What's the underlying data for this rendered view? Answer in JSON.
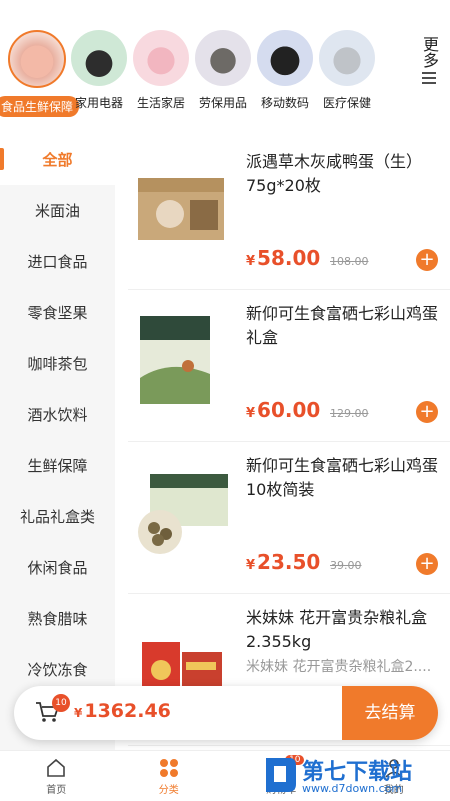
{
  "top_categories": [
    {
      "label": "食品生鲜保障",
      "active": true
    },
    {
      "label": "家用电器",
      "active": false
    },
    {
      "label": "生活家居",
      "active": false
    },
    {
      "label": "劳保用品",
      "active": false
    },
    {
      "label": "移动数码",
      "active": false
    },
    {
      "label": "医疗保健",
      "active": false
    }
  ],
  "more_label": "更多",
  "sidebar": {
    "items": [
      {
        "label": "全部",
        "active": true
      },
      {
        "label": "米面油"
      },
      {
        "label": "进口食品"
      },
      {
        "label": "零食坚果"
      },
      {
        "label": "咖啡茶包"
      },
      {
        "label": "酒水饮料"
      },
      {
        "label": "生鲜保障"
      },
      {
        "label": "礼品礼盒类"
      },
      {
        "label": "休闲食品"
      },
      {
        "label": "熟食腊味"
      },
      {
        "label": "冷饮冻食"
      }
    ]
  },
  "products": [
    {
      "name": "派遇草木灰咸鸭蛋（生）75g*20枚",
      "price": "58.00",
      "orig": "108.00"
    },
    {
      "name": "新仰可生食富硒七彩山鸡蛋礼盒",
      "price": "60.00",
      "orig": "129.00"
    },
    {
      "name": "新仰可生食富硒七彩山鸡蛋10枚简装",
      "price": "23.50",
      "orig": "39.00"
    },
    {
      "name": "米妹妹 花开富贵杂粮礼盒2.355kg",
      "sub": "米妹妹 花开富贵杂粮礼盒2...."
    }
  ],
  "currency": "¥",
  "add_symbol": "+",
  "cart": {
    "count": "10",
    "total": "1362.46",
    "checkout_label": "去结算"
  },
  "bottom_nav": [
    {
      "label": "首页",
      "icon": "home-icon"
    },
    {
      "label": "分类",
      "icon": "category-icon",
      "active": true
    },
    {
      "label": "购物车",
      "icon": "cart-icon",
      "badge": "10"
    },
    {
      "label": "我的",
      "icon": "user-icon"
    }
  ],
  "watermark": {
    "text": "第七下载站",
    "url": "www.d7down.com"
  },
  "colors": {
    "accent": "#f07a2b",
    "price": "#e8502a"
  }
}
